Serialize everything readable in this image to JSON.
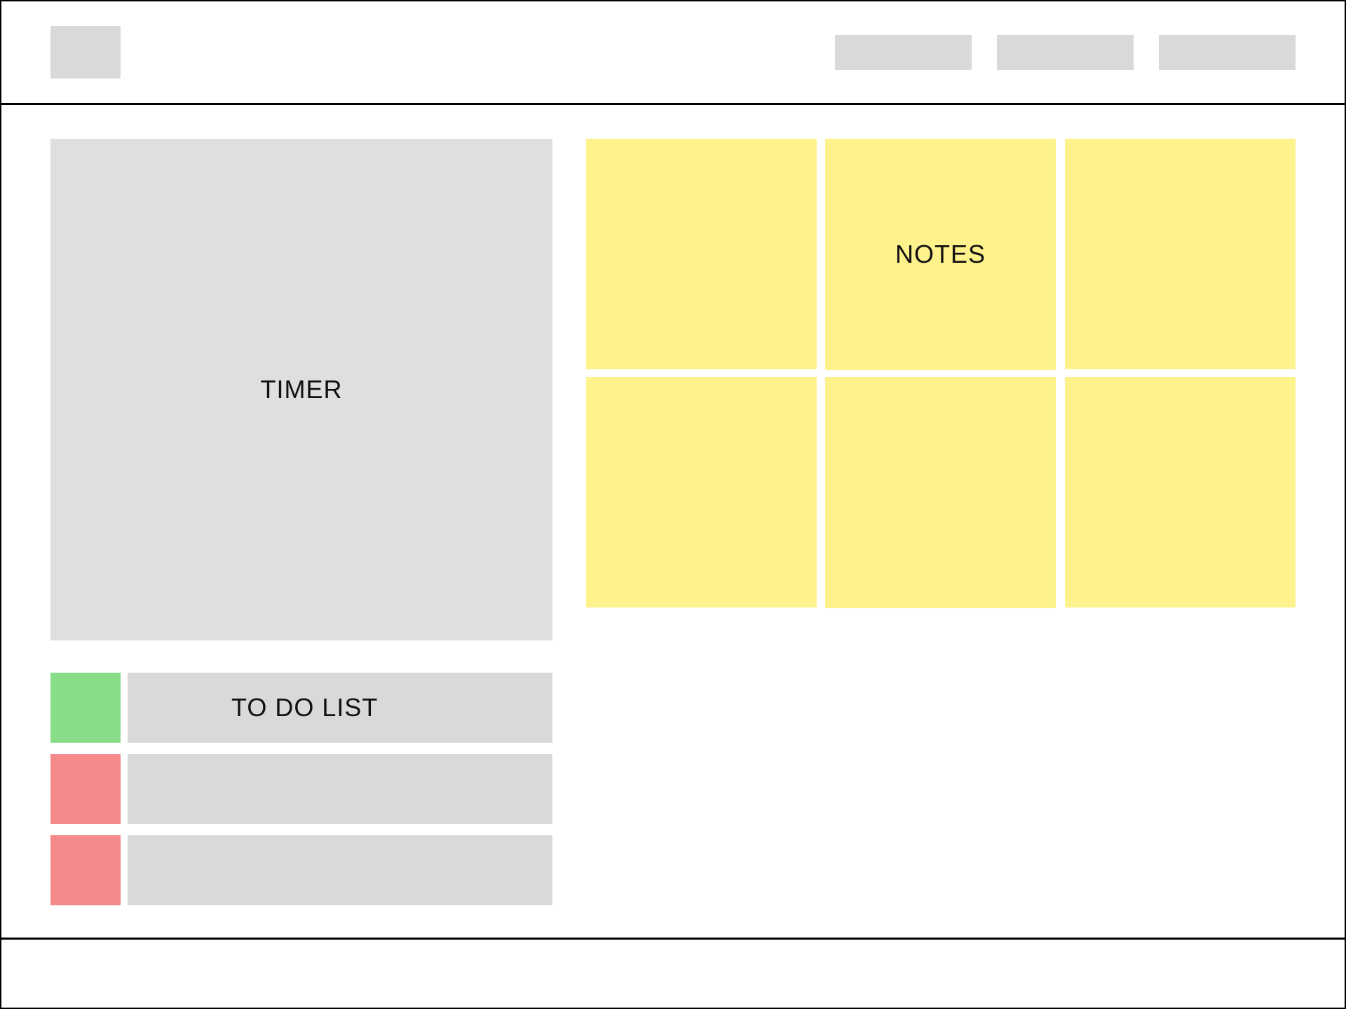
{
  "timer": {
    "label": "TIMER"
  },
  "notes": {
    "label": "NOTES",
    "count": 6,
    "color": "#fef28d"
  },
  "todo": {
    "label": "TO DO LIST",
    "items": [
      {
        "status": "done",
        "color": "#88dd88"
      },
      {
        "status": "pending",
        "color": "#f58a8a"
      },
      {
        "status": "pending",
        "color": "#f58a8a"
      }
    ]
  },
  "colors": {
    "placeholder": "#d9d9d9",
    "timer_bg": "#dfdfdf",
    "border": "#000000"
  }
}
